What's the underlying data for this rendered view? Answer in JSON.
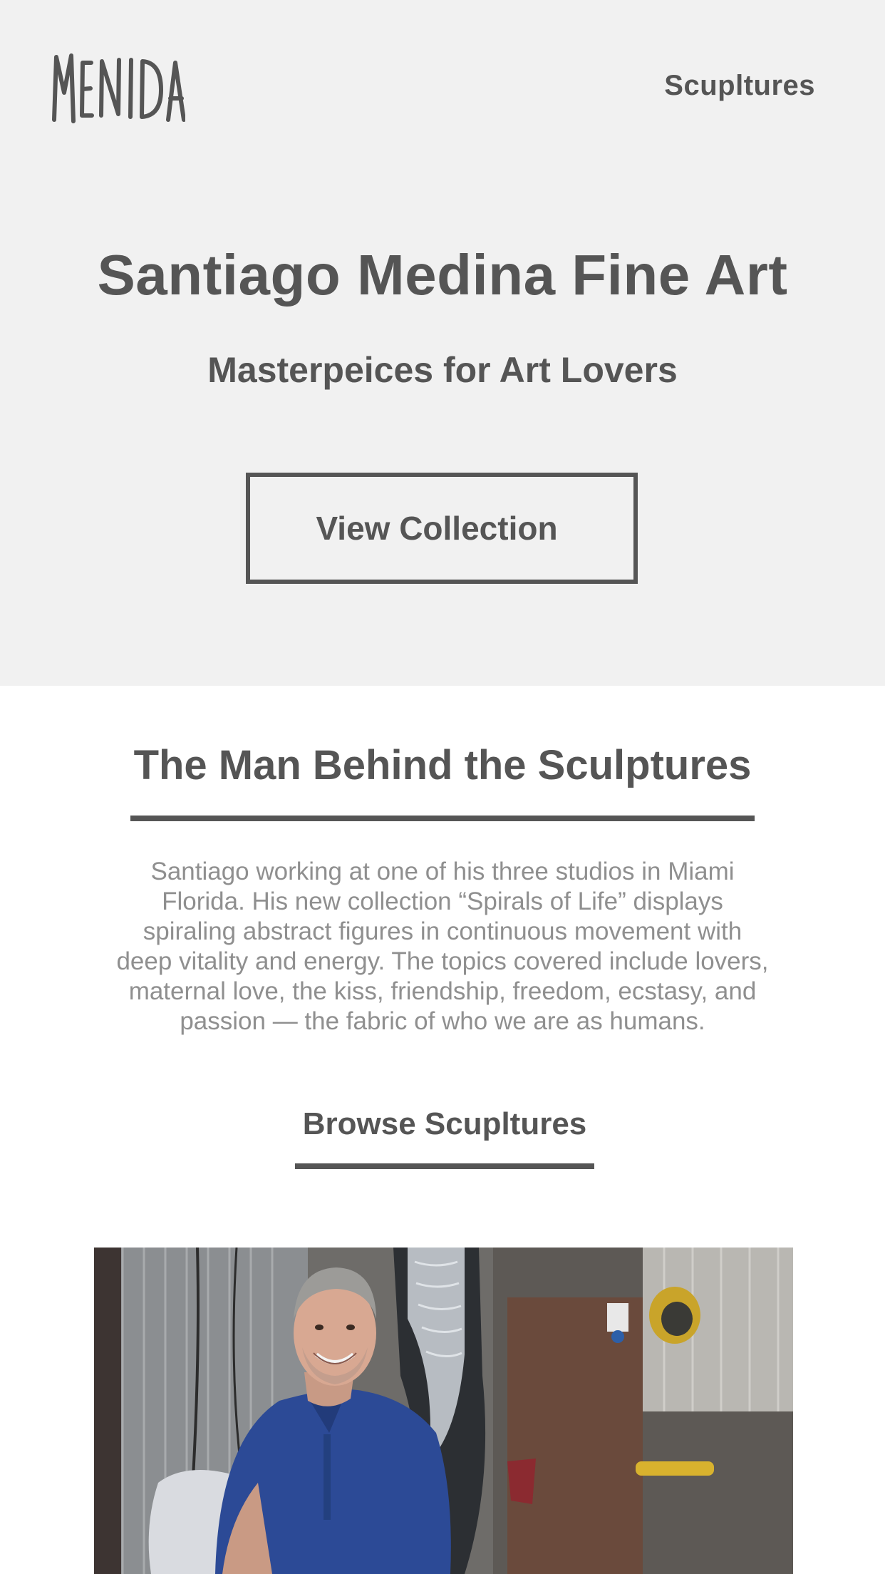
{
  "header": {
    "logo_text": "MENIDA",
    "nav_link_label": "Scupltures"
  },
  "hero": {
    "title": "Santiago Medina Fine Art",
    "subtitle": "Masterpeices for Art Lovers",
    "cta_label": "View Collection"
  },
  "about": {
    "heading": "The Man Behind the Sculptures",
    "body": "Santiago working at one of his three studios in Miami Florida. His new collection “Spirals of Life” displays spiraling abstract figures in continuous movement with deep vitality and energy. The topics covered include lovers, maternal love, the kiss, friendship, freedom, ecstasy, and passion — the fabric of who we are as humans.",
    "browse_link_label": "Browse Scupltures"
  },
  "colors": {
    "hero_background": "#f1f1f1",
    "text_primary": "#555555",
    "text_body": "#8f8f8f",
    "page_background": "#ffffff"
  },
  "photo": {
    "icon": "artist-portrait-photo"
  }
}
